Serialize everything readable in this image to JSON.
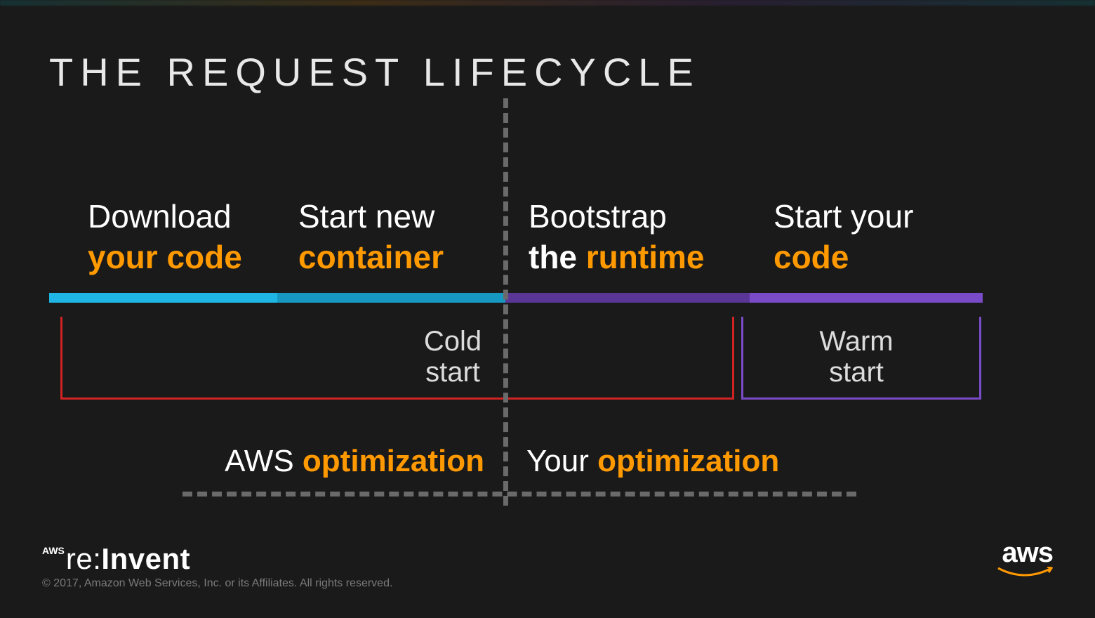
{
  "title": "THE REQUEST LIFECYCLE",
  "phases": [
    {
      "line1": "Download",
      "line2_prefix": "",
      "line2_hl": "your code"
    },
    {
      "line1": "Start new",
      "line2_prefix": "",
      "line2_hl": "container"
    },
    {
      "line1": "Bootstrap",
      "line2_prefix": "the ",
      "line2_hl": "runtime"
    },
    {
      "line1": "Start your",
      "line2_prefix": "",
      "line2_hl": "code"
    }
  ],
  "coldstart": {
    "l1": "Cold",
    "l2": "start"
  },
  "warmstart": {
    "l1": "Warm",
    "l2": "start"
  },
  "optimization": {
    "left_plain": "AWS ",
    "left_hl": "optimization",
    "right_plain": "Your ",
    "right_hl": "optimization"
  },
  "footer": {
    "reinvent_aws": "AWS",
    "reinvent_re": "re:",
    "reinvent_invent": "Invent",
    "copyright": "© 2017, Amazon Web Services, Inc. or its Affiliates. All rights reserved.",
    "aws_logo": "aws"
  },
  "colors": {
    "accent": "#ff9900",
    "blue1": "#1fb6e6",
    "blue2": "#1798c2",
    "purple1": "#5a3796",
    "purple2": "#7a4bc8",
    "red": "#d22323"
  }
}
